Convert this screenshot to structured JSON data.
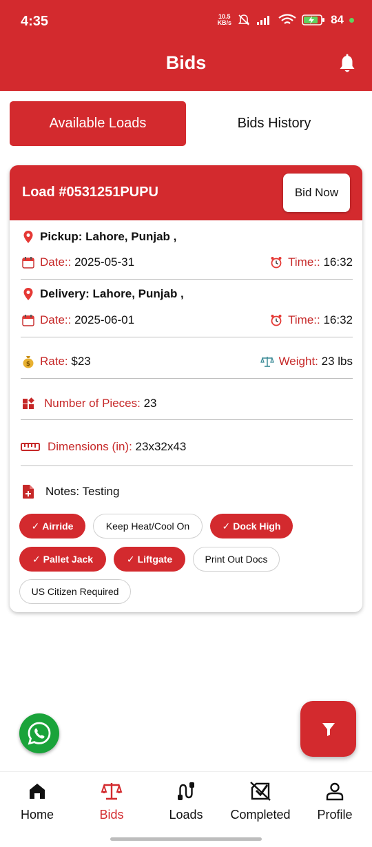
{
  "status": {
    "time": "4:35",
    "net_speed_top": "10.5",
    "net_speed_bottom": "KB/s",
    "battery": "84"
  },
  "appbar": {
    "title": "Bids"
  },
  "tabs": [
    {
      "label": "Available Loads",
      "active": true
    },
    {
      "label": "Bids History",
      "active": false
    }
  ],
  "load": {
    "number": "Load #0531251PUPU",
    "bid_button": "Bid Now",
    "pickup": {
      "label": "Pickup: Lahore, Punjab ,",
      "date_label": "Date::",
      "date": "2025-05-31",
      "time_label": "Time::",
      "time": "16:32"
    },
    "delivery": {
      "label": "Delivery: Lahore, Punjab ,",
      "date_label": "Date::",
      "date": "2025-06-01",
      "time_label": "Time::",
      "time": "16:32"
    },
    "rate_label": "Rate:",
    "rate": "$23",
    "weight_label": "Weight:",
    "weight": "23 lbs",
    "pieces_label": "Number of Pieces:",
    "pieces": "23",
    "dimensions_label": "Dimensions (in):",
    "dimensions": "23x32x43",
    "notes": "Notes: Testing",
    "features": [
      {
        "label": "Airride",
        "selected": true
      },
      {
        "label": "Keep Heat/Cool On",
        "selected": false
      },
      {
        "label": "Dock High",
        "selected": true
      },
      {
        "label": "Pallet Jack",
        "selected": true
      },
      {
        "label": "Liftgate",
        "selected": true
      },
      {
        "label": "Print Out Docs",
        "selected": false
      },
      {
        "label": "US Citizen Required",
        "selected": false
      }
    ]
  },
  "nav": [
    {
      "label": "Home",
      "icon": "home-icon",
      "active": false
    },
    {
      "label": "Bids",
      "icon": "scale-icon",
      "active": true
    },
    {
      "label": "Loads",
      "icon": "route-icon",
      "active": false
    },
    {
      "label": "Completed",
      "icon": "completed-icon",
      "active": false
    },
    {
      "label": "Profile",
      "icon": "person-icon",
      "active": false
    }
  ],
  "colors": {
    "primary": "#d32a2e",
    "whatsapp": "#1aa33a"
  }
}
